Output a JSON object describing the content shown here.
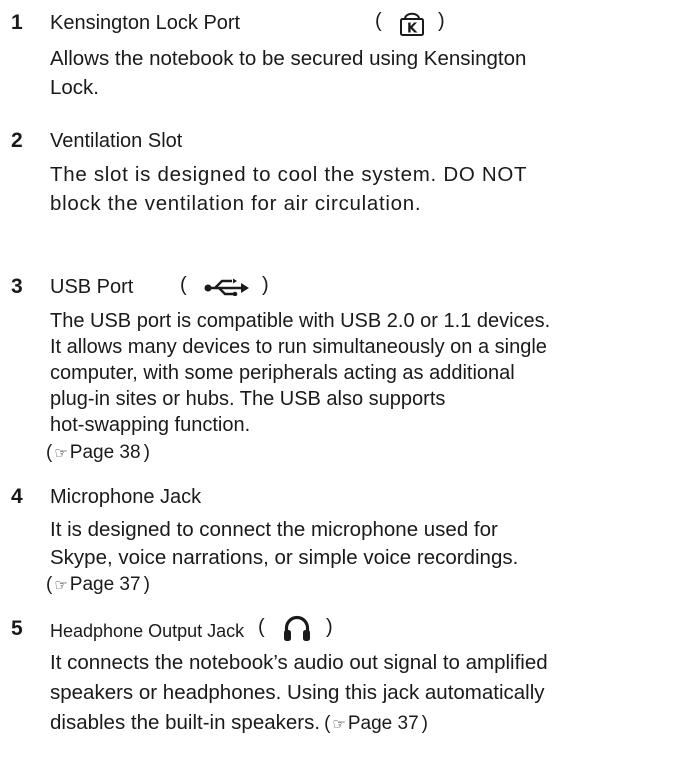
{
  "items": [
    {
      "number": "1",
      "title": "Kensington Lock Port",
      "icon": "kensington-lock-icon",
      "desc_lines": [
        "Allows the notebook to be secured using Kensington",
        "Lock."
      ]
    },
    {
      "number": "2",
      "title": "Ventilation Slot",
      "desc_lines": [
        "The slot is designed to cool the system. DO NOT",
        "block the ventilation for air circulation."
      ]
    },
    {
      "number": "3",
      "title": "USB Port",
      "icon": "usb-icon",
      "desc_lines": [
        "The USB port is compatible with USB 2.0 or 1.1 devices.",
        "It allows many devices to run simultaneously on a single",
        "computer, with some peripherals acting as additional",
        "plug-in sites or hubs. The USB also supports",
        "hot-swapping function."
      ],
      "page_ref": "Page 38"
    },
    {
      "number": "4",
      "title": "Microphone Jack",
      "desc_lines": [
        "It is designed to connect the microphone used for",
        "Skype, voice narrations, or simple voice recordings."
      ],
      "page_ref": "Page 37"
    },
    {
      "number": "5",
      "title": "Headphone Output Jack",
      "icon": "headphone-icon",
      "desc_lines": [
        "It connects the notebook’s audio out signal to amplified",
        "speakers or headphones. Using this jack automatically",
        "disables the built-in speakers."
      ],
      "page_ref": "Page 37"
    }
  ],
  "glyphs": {
    "paren_open": "(",
    "paren_close": ")",
    "pointing_hand": "☞"
  }
}
